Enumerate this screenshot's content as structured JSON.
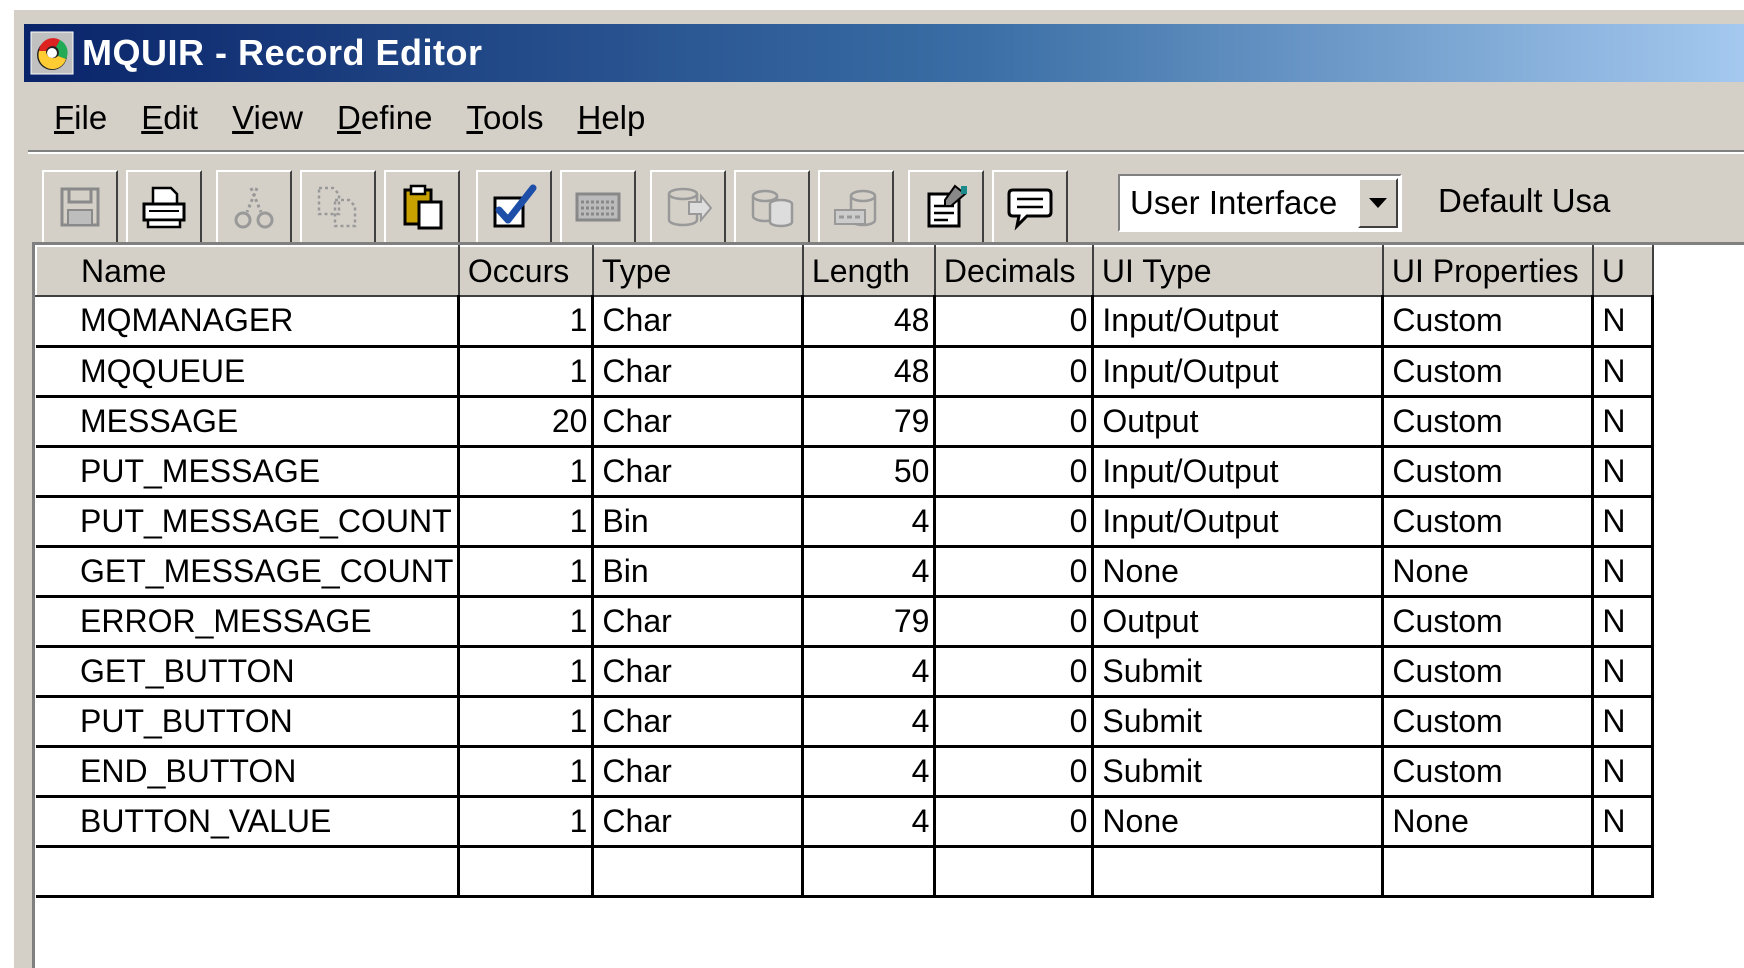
{
  "window": {
    "title": "MQUIR - Record Editor",
    "app_icon": "record-editor-app-icon"
  },
  "menu": [
    {
      "label": "File",
      "accel": "F",
      "rest": "ile"
    },
    {
      "label": "Edit",
      "accel": "E",
      "rest": "dit"
    },
    {
      "label": "View",
      "accel": "V",
      "rest": "iew"
    },
    {
      "label": "Define",
      "accel": "D",
      "rest": "efine"
    },
    {
      "label": "Tools",
      "accel": "T",
      "rest": "ools"
    },
    {
      "label": "Help",
      "accel": "H",
      "rest": "elp"
    }
  ],
  "toolbar": {
    "buttons": [
      {
        "icon": "save-icon",
        "enabled": false
      },
      {
        "icon": "print-icon",
        "enabled": true
      },
      {
        "icon": "cut-icon",
        "enabled": false
      },
      {
        "icon": "copy-icon",
        "enabled": false
      },
      {
        "icon": "paste-icon",
        "enabled": true
      },
      {
        "icon": "validate-checkmark-icon",
        "enabled": true
      },
      {
        "icon": "keyboard-icon",
        "enabled": false
      },
      {
        "icon": "database-export-icon",
        "enabled": false
      },
      {
        "icon": "database-copy-icon",
        "enabled": false
      },
      {
        "icon": "sql-database-icon",
        "enabled": false
      },
      {
        "icon": "properties-icon",
        "enabled": true
      },
      {
        "icon": "comment-icon",
        "enabled": true
      }
    ],
    "view_select": {
      "value": "User Interface"
    },
    "default_usage_label": "Default Usa"
  },
  "grid": {
    "columns": [
      "Name",
      "Occurs",
      "Type",
      "Length",
      "Decimals",
      "UI Type",
      "UI Properties",
      "U"
    ],
    "rows": [
      {
        "name": "MQMANAGER",
        "occurs": "1",
        "type": "Char",
        "length": "48",
        "decimals": "0",
        "ui_type": "Input/Output",
        "ui_properties": "Custom",
        "extra": "N"
      },
      {
        "name": "MQQUEUE",
        "occurs": "1",
        "type": "Char",
        "length": "48",
        "decimals": "0",
        "ui_type": "Input/Output",
        "ui_properties": "Custom",
        "extra": "N"
      },
      {
        "name": "MESSAGE",
        "occurs": "20",
        "type": "Char",
        "length": "79",
        "decimals": "0",
        "ui_type": "Output",
        "ui_properties": "Custom",
        "extra": "N"
      },
      {
        "name": "PUT_MESSAGE",
        "occurs": "1",
        "type": "Char",
        "length": "50",
        "decimals": "0",
        "ui_type": "Input/Output",
        "ui_properties": "Custom",
        "extra": "N"
      },
      {
        "name": "PUT_MESSAGE_COUNT",
        "occurs": "1",
        "type": "Bin",
        "length": "4",
        "decimals": "0",
        "ui_type": "Input/Output",
        "ui_properties": "Custom",
        "extra": "N"
      },
      {
        "name": "GET_MESSAGE_COUNT",
        "occurs": "1",
        "type": "Bin",
        "length": "4",
        "decimals": "0",
        "ui_type": "None",
        "ui_properties": "None",
        "extra": "N"
      },
      {
        "name": "ERROR_MESSAGE",
        "occurs": "1",
        "type": "Char",
        "length": "79",
        "decimals": "0",
        "ui_type": "Output",
        "ui_properties": "Custom",
        "extra": "N"
      },
      {
        "name": "GET_BUTTON",
        "occurs": "1",
        "type": "Char",
        "length": "4",
        "decimals": "0",
        "ui_type": "Submit",
        "ui_properties": "Custom",
        "extra": "N"
      },
      {
        "name": "PUT_BUTTON",
        "occurs": "1",
        "type": "Char",
        "length": "4",
        "decimals": "0",
        "ui_type": "Submit",
        "ui_properties": "Custom",
        "extra": "N"
      },
      {
        "name": "END_BUTTON",
        "occurs": "1",
        "type": "Char",
        "length": "4",
        "decimals": "0",
        "ui_type": "Submit",
        "ui_properties": "Custom",
        "extra": "N"
      },
      {
        "name": "BUTTON_VALUE",
        "occurs": "1",
        "type": "Char",
        "length": "4",
        "decimals": "0",
        "ui_type": "None",
        "ui_properties": "None",
        "extra": "N"
      },
      {
        "name": "",
        "occurs": "",
        "type": "",
        "length": "",
        "decimals": "",
        "ui_type": "",
        "ui_properties": "",
        "extra": ""
      }
    ]
  },
  "colors": {
    "titlebar_start": "#0a246a",
    "titlebar_end": "#a6caf0",
    "chrome": "#d4d0c8",
    "checkmark": "#1e4fa8"
  }
}
